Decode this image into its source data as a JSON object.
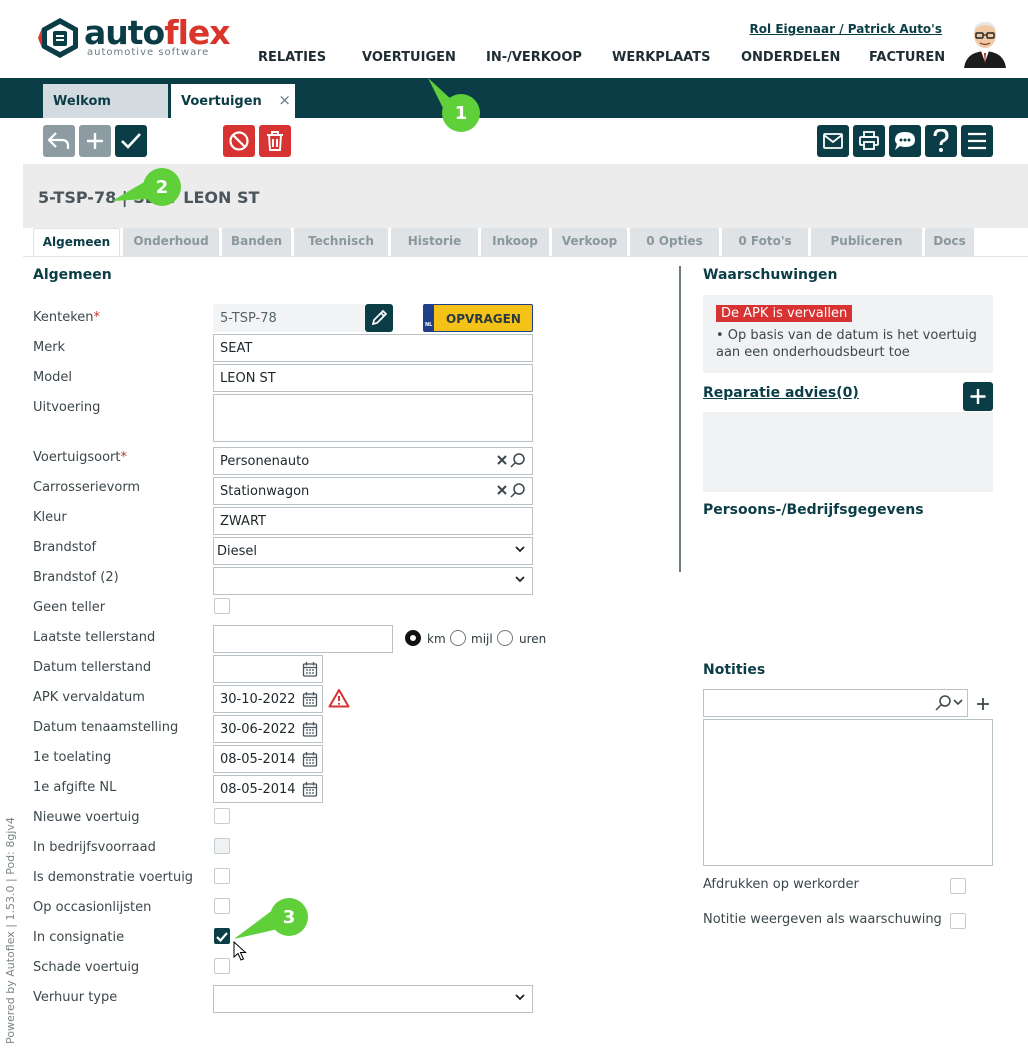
{
  "brand": {
    "name_a": "auto",
    "name_x": "flex",
    "tagline": "automotive software"
  },
  "user": {
    "link": "Rol Eigenaar / Patrick Auto's"
  },
  "nav": [
    "RELATIES",
    "VOERTUIGEN",
    "IN-/VERKOOP",
    "WERKPLAATS",
    "ONDERDELEN",
    "FACTUREN"
  ],
  "window_tabs": {
    "welkom": "Welkom",
    "voertuigen": "Voertuigen",
    "close": "×"
  },
  "side_text": "Powered by Autoflex | 1.53.0 | Pod: 8gjv4",
  "vehicle_title": "5-TSP-78 | SEAT LEON ST",
  "subtabs": [
    "Algemeen",
    "Onderhoud",
    "Banden",
    "Technisch",
    "Historie",
    "Inkoop",
    "Verkoop",
    "0 Opties",
    "0 Foto's",
    "Publiceren",
    "Docs"
  ],
  "sections": {
    "algemeen": "Algemeen",
    "waarschuwingen": "Waarschuwingen",
    "reparatie": "Reparatie advies",
    "reparatie_count": "(0)",
    "persoons": "Persoons-/Bedrijfsgegevens",
    "notities": "Notities"
  },
  "form": {
    "kenteken_label": "Kenteken",
    "kenteken_value": "5-TSP-78",
    "opvragen": "OPVRAGEN",
    "merk_label": "Merk",
    "merk_value": "SEAT",
    "model_label": "Model",
    "model_value": "LEON ST",
    "uitvoering_label": "Uitvoering",
    "voertuigsoort_label": "Voertuigsoort",
    "voertuigsoort_value": "Personenauto",
    "carrosserie_label": "Carrosserievorm",
    "carrosserie_value": "Stationwagon",
    "kleur_label": "Kleur",
    "kleur_value": "ZWART",
    "brandstof_label": "Brandstof",
    "brandstof_value": "Diesel",
    "brandstof2_label": "Brandstof (2)",
    "geen_teller_label": "Geen teller",
    "laatste_teller_label": "Laatste tellerstand",
    "unit_km": "km",
    "unit_mijl": "mijl",
    "unit_uren": "uren",
    "datum_teller_label": "Datum tellerstand",
    "apk_label": "APK vervaldatum",
    "apk_value": "30-10-2022",
    "tenaam_label": "Datum tenaamstelling",
    "tenaam_value": "30-06-2022",
    "toelating_label": "1e toelating",
    "toelating_value": "08-05-2014",
    "afgifte_label": "1e afgifte NL",
    "afgifte_value": "08-05-2014",
    "nieuw_label": "Nieuwe voertuig",
    "voorraad_label": "In bedrijfsvoorraad",
    "demo_label": "Is demonstratie voertuig",
    "occasion_label": "Op occasionlijsten",
    "consignatie_label": "In consignatie",
    "schade_label": "Schade voertuig",
    "verhuur_label": "Verhuur type"
  },
  "warnings": {
    "badge": "De APK is vervallen",
    "text": "• Op basis van de datum is het voertuig aan een onderhoudsbeurt toe"
  },
  "notes": {
    "print_label": "Afdrukken op werkorder",
    "warn_label": "Notitie weergeven als waarschuwing"
  },
  "callouts": [
    "1",
    "2",
    "3"
  ],
  "colors": {
    "primary": "#0b3d47",
    "danger": "#d83333",
    "callout": "#5fcf3a",
    "opvragen": "#f5c218"
  }
}
